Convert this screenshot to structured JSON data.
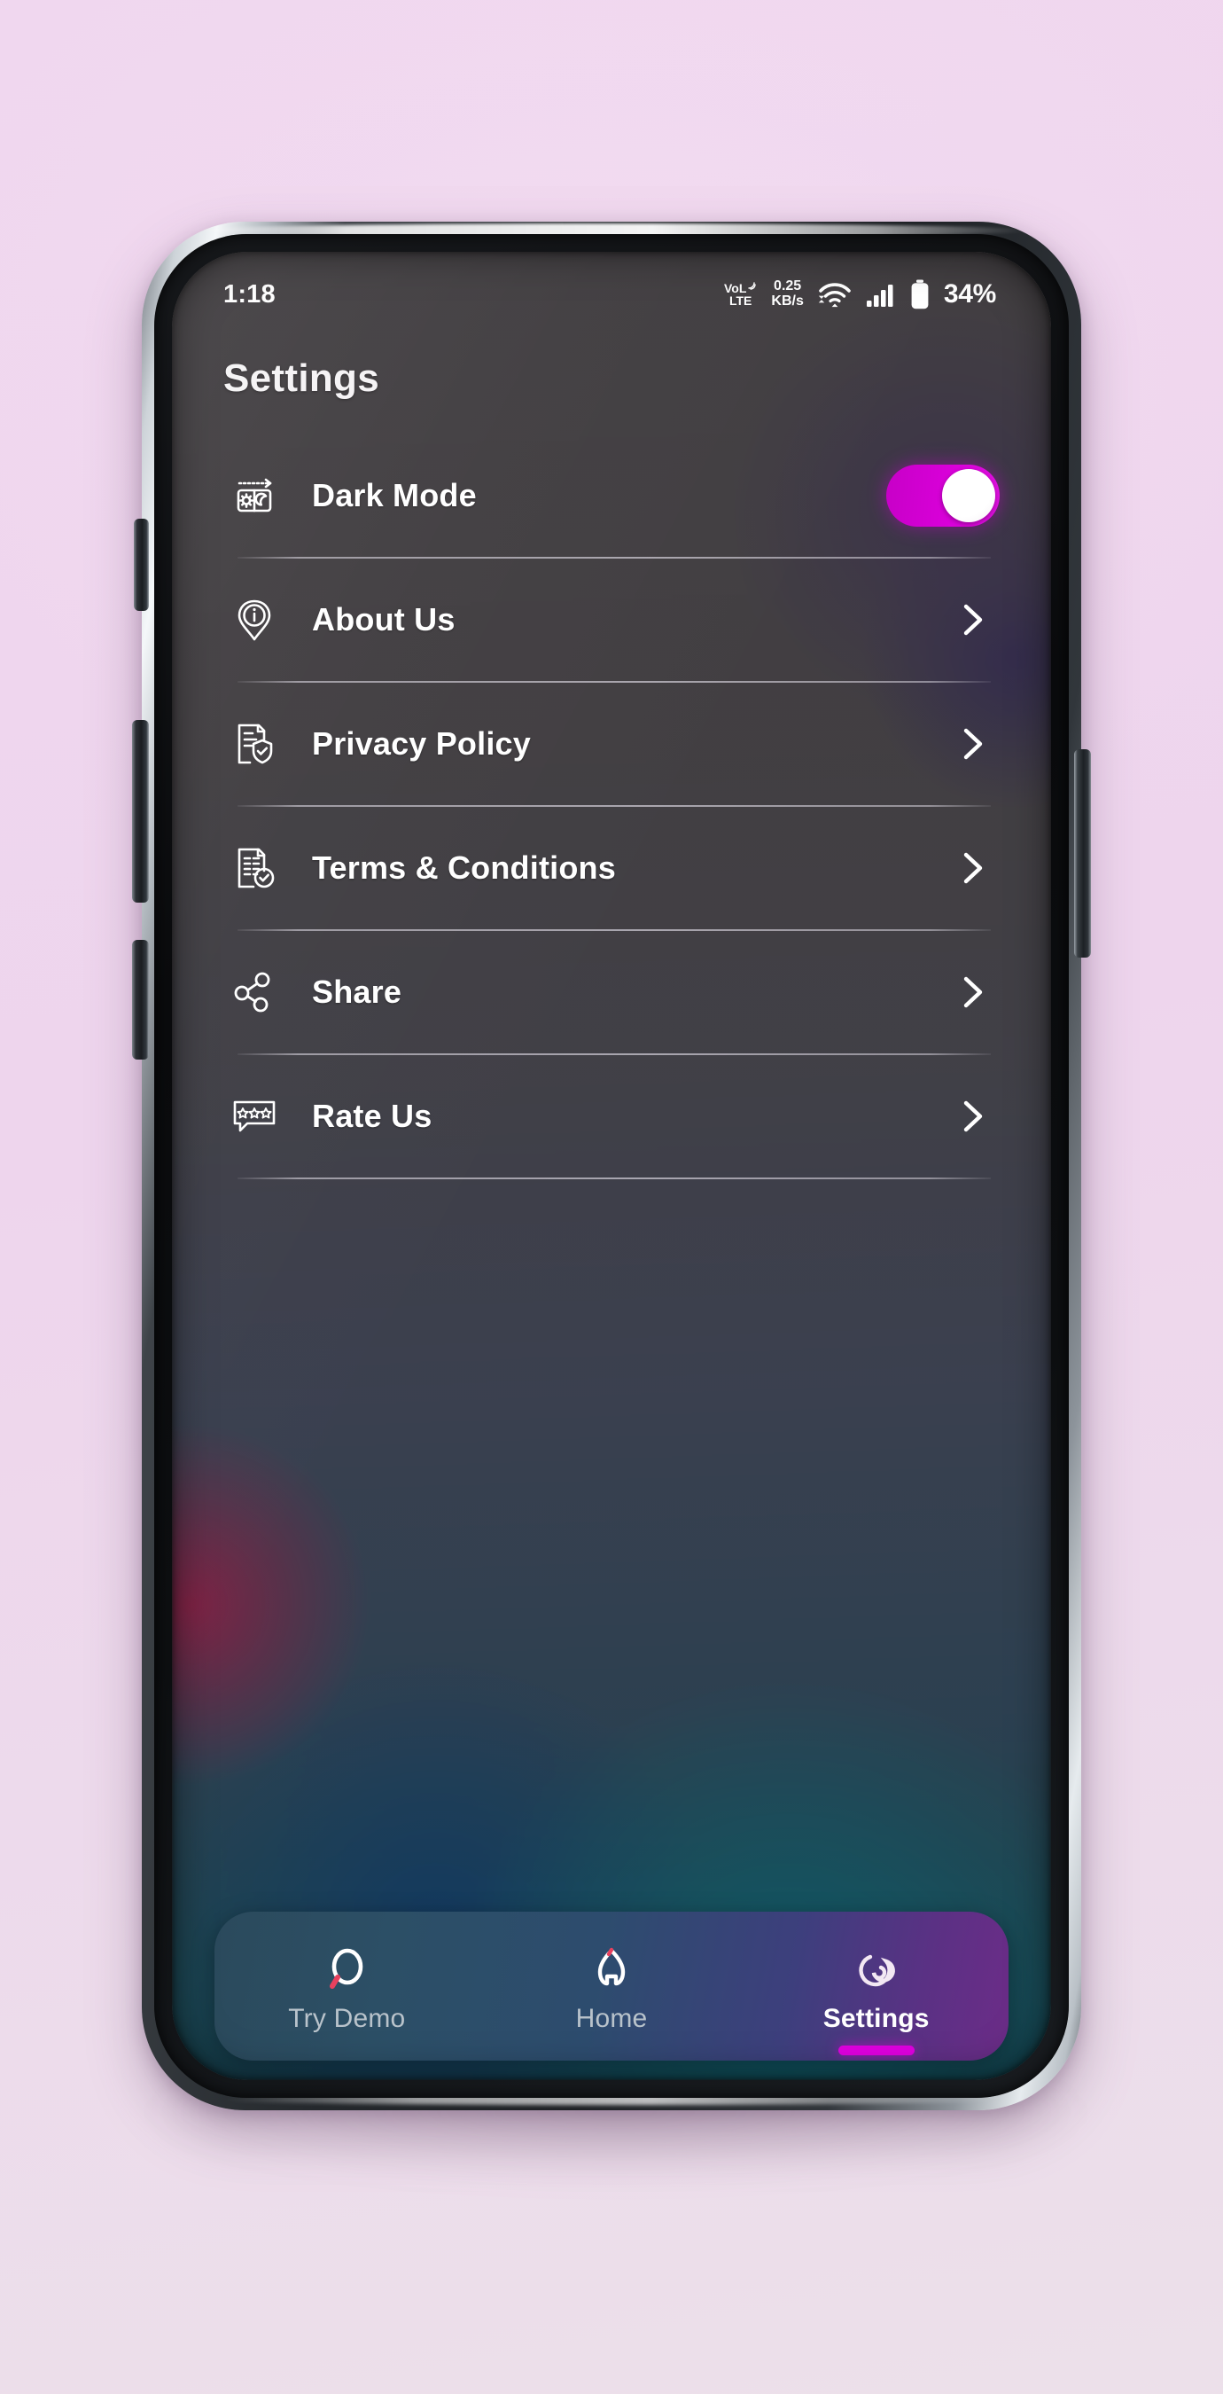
{
  "status_bar": {
    "time": "1:18",
    "volte_top": "VoL",
    "volte_bottom": "LTE",
    "net_speed_value": "0.25",
    "net_speed_unit": "KB/s",
    "wifi_icon": "wifi-icon",
    "signal_icon": "cellular-signal-icon",
    "battery_icon": "battery-icon",
    "battery_percent": "34%"
  },
  "header": {
    "title": "Settings"
  },
  "settings": {
    "rows": [
      {
        "label": "Dark Mode",
        "icon": "dark-mode-sun-moon-icon",
        "control": "toggle",
        "toggle_on": true,
        "toggle_color": "#d600d6",
        "knob_color": "#ffffff"
      },
      {
        "label": "About Us",
        "icon": "info-pin-icon",
        "control": "chevron",
        "chevron_icon": "chevron-right-icon"
      },
      {
        "label": "Privacy Policy",
        "icon": "document-shield-icon",
        "control": "chevron",
        "chevron_icon": "chevron-right-icon"
      },
      {
        "label": "Terms & Conditions",
        "icon": "document-check-icon",
        "control": "chevron",
        "chevron_icon": "chevron-right-icon"
      },
      {
        "label": "Share",
        "icon": "share-nodes-icon",
        "control": "chevron",
        "chevron_icon": "chevron-right-icon"
      },
      {
        "label": "Rate Us",
        "icon": "rate-stars-bubble-icon",
        "control": "chevron",
        "chevron_icon": "chevron-right-icon"
      }
    ]
  },
  "bottom_nav": {
    "active_index": 2,
    "active_accent": "#e000e0",
    "items": [
      {
        "label": "Try Demo",
        "icon": "try-demo-icon",
        "active": false
      },
      {
        "label": "Home",
        "icon": "home-icon",
        "active": false
      },
      {
        "label": "Settings",
        "icon": "settings-spiral-icon",
        "active": true
      }
    ]
  },
  "colors": {
    "page_background": "#eed6ee",
    "screen_base": "#45434a",
    "accent_magenta": "#d600d6",
    "text_primary": "#ffffff",
    "text_muted": "#b9c3cb"
  }
}
